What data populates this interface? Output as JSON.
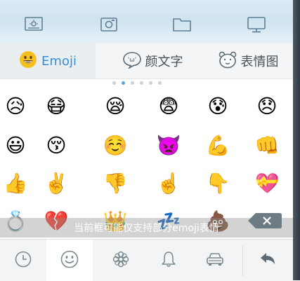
{
  "toolbar": {
    "icons": [
      "weather-icon",
      "camera-icon",
      "folder-icon",
      "monitor-icon"
    ]
  },
  "tabs": [
    {
      "label": "Emoji",
      "icon": "grinning-face-icon",
      "active": true
    },
    {
      "label": "颜文字",
      "icon": "speech-bubble-face-icon",
      "active": false
    },
    {
      "label": "表情图",
      "icon": "bear-face-icon",
      "active": false
    }
  ],
  "pager": {
    "count": 6,
    "active_index": 1
  },
  "emoji_rows": [
    [
      "😥",
      "😷",
      "😪",
      "😨",
      "😰",
      "😞"
    ],
    [
      "😃",
      "😚",
      "☺️",
      "👿",
      "💪",
      "👊"
    ],
    [
      "👍",
      "✌️",
      "👎",
      "☝️",
      "👇",
      "💝"
    ],
    [
      "💍",
      "💔",
      "👑",
      "💤",
      "💩"
    ]
  ],
  "hint": "当前框可能仅支持部分emoji表情",
  "bottom_bar": {
    "icons": [
      "clock-icon",
      "smiley-icon",
      "flower-icon",
      "bell-icon",
      "car-icon",
      "return-icon"
    ],
    "active_index": 1
  },
  "colors": {
    "accent": "#3a8fd7",
    "tab_text": "#4a5259"
  }
}
